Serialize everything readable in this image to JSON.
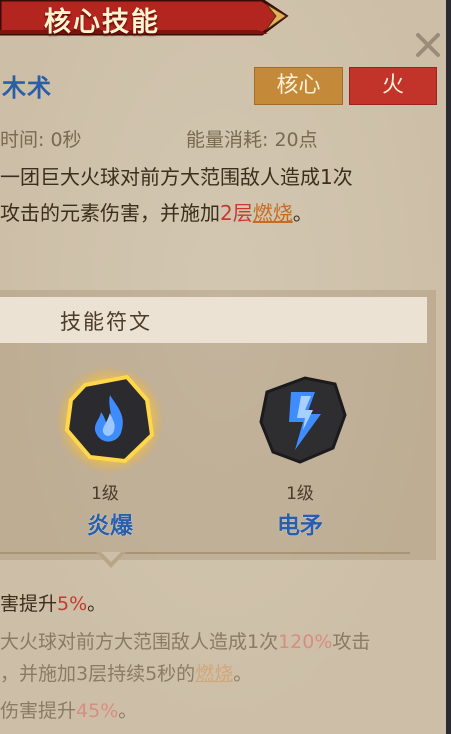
{
  "header": {
    "title": "核心技能"
  },
  "skill": {
    "name_partial": "木术",
    "tags": {
      "core": "核心",
      "element": "火"
    },
    "cast_time": "时间: 0秒",
    "energy_cost": "能量消耗: 20点",
    "desc_line1": "一团巨大火球对前方大范围敌人造成1次",
    "desc_line2_a": "攻击的元素伤害，并施加",
    "desc_line2_num": "2层",
    "desc_line2_burn": "燃烧",
    "desc_line2_end": "。"
  },
  "runes": {
    "header": "技能符文",
    "items": [
      {
        "level": "1级",
        "name": "炎爆",
        "icon": "fire-rune-icon"
      },
      {
        "level": "1级",
        "name": "电矛",
        "icon": "lightning-rune-icon"
      }
    ]
  },
  "bonus": {
    "line1_a": "害提升",
    "line1_pct": "5%",
    "line1_end": "。",
    "line2_a": "大火球对前方大范围敌人造成1次",
    "line2_pct": "120%",
    "line2_end": "攻击",
    "line3_a": "，并施加3层持续5秒的",
    "line3_burn": "燃烧",
    "line3_end": "。",
    "line4_a": "伤害提升",
    "line4_pct": "45%",
    "line4_end": "。"
  },
  "colors": {
    "panel": "#cdbfa7",
    "banner_red": "#b2261f",
    "tag_core": "#c48a3a",
    "tag_fire": "#c2332a",
    "rune_name_blue": "#2a5ea8",
    "highlight_red": "#c63a2e"
  }
}
